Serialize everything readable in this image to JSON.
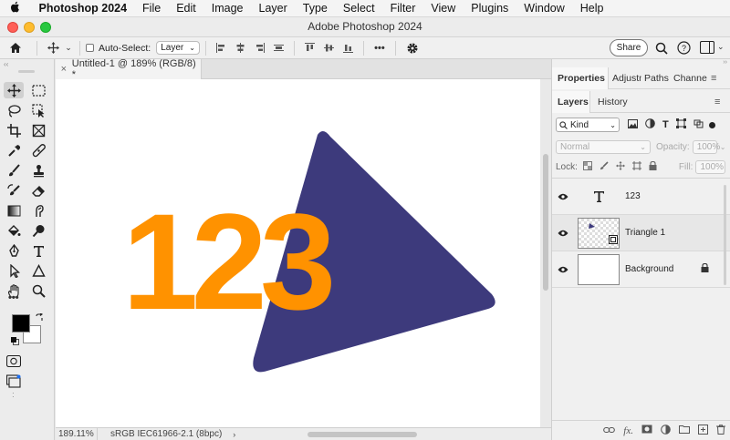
{
  "menubar": {
    "app_name": "Photoshop 2024",
    "items": [
      "File",
      "Edit",
      "Image",
      "Layer",
      "Type",
      "Select",
      "Filter",
      "View",
      "Plugins",
      "Window",
      "Help"
    ]
  },
  "window": {
    "title": "Adobe Photoshop 2024"
  },
  "options_bar": {
    "auto_select_label": "Auto-Select:",
    "auto_select_target": "Layer",
    "more_label": "•••",
    "share_label": "Share"
  },
  "toolbox": {
    "more_label": "•••"
  },
  "document": {
    "tab_label": "Untitled-1 @ 189% (RGB/8) *",
    "zoom": "189.11%",
    "color_profile": "sRGB IEC61966-2.1 (8bpc)",
    "artwork_text": "123",
    "colors": {
      "number_fill": "#ff9200",
      "triangle_fill": "#3d3a7c"
    }
  },
  "panels": {
    "top_tabs": [
      "Properties",
      "Adjustm",
      "Paths",
      "Channe"
    ],
    "layer_tabs": [
      "Layers",
      "History"
    ],
    "filter_kind": "Kind",
    "blend_mode": "Normal",
    "opacity_label": "Opacity:",
    "opacity_value": "100%",
    "lock_label": "Lock:",
    "fill_label": "Fill:",
    "fill_value": "100%",
    "layers": [
      {
        "name": "123",
        "kind": "type"
      },
      {
        "name": "Triangle 1",
        "kind": "shape"
      },
      {
        "name": "Background",
        "kind": "background",
        "locked": true
      }
    ]
  }
}
